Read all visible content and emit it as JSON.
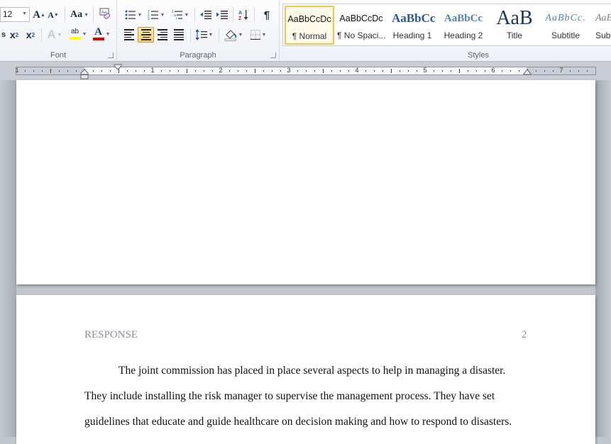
{
  "ribbon": {
    "font": {
      "label": "Font",
      "size_value": "12",
      "grow_label": "A",
      "shrink_label": "A",
      "case_label": "Aa",
      "subscript_label": "x",
      "subscript_sub": "2",
      "superscript_label": "x",
      "superscript_sup": "2",
      "effects_label": "A",
      "highlight_label": "ab",
      "font_color_label": "A",
      "colors": {
        "highlight": "#ffff00",
        "font_color": "#e00000"
      }
    },
    "paragraph": {
      "label": "Paragraph",
      "pilcrow": "¶",
      "sort_label": "A↓"
    },
    "styles": {
      "label": "Styles",
      "items": [
        {
          "preview": "AaBbCcDc",
          "name": "¶ Normal",
          "selected": true
        },
        {
          "preview": "AaBbCcDc",
          "name": "¶ No Spaci...",
          "selected": false
        },
        {
          "preview": "AaBbCc",
          "name": "Heading 1",
          "selected": false
        },
        {
          "preview": "AaBbCc",
          "name": "Heading 2",
          "selected": false
        },
        {
          "preview": "AaB",
          "name": "Title",
          "selected": false
        },
        {
          "preview": "AaBbCc.",
          "name": "Subtitle",
          "selected": false
        },
        {
          "preview": "AaBbCc",
          "name": "Subtle Em...",
          "selected": false
        }
      ]
    }
  },
  "ruler": {
    "numbers": [
      "1",
      "1",
      "2",
      "3",
      "4",
      "5",
      "6",
      "7"
    ]
  },
  "document": {
    "page2": {
      "running_head": "RESPONSE",
      "page_number": "2",
      "lines": [
        "The joint commission  has placed in place several aspects to help in managing a disaster.",
        "They include installing  the risk manager to supervise the management  process.  They have set",
        "guidelines that educate and guide healthcare on decision making  and how to respond to disasters."
      ]
    }
  }
}
